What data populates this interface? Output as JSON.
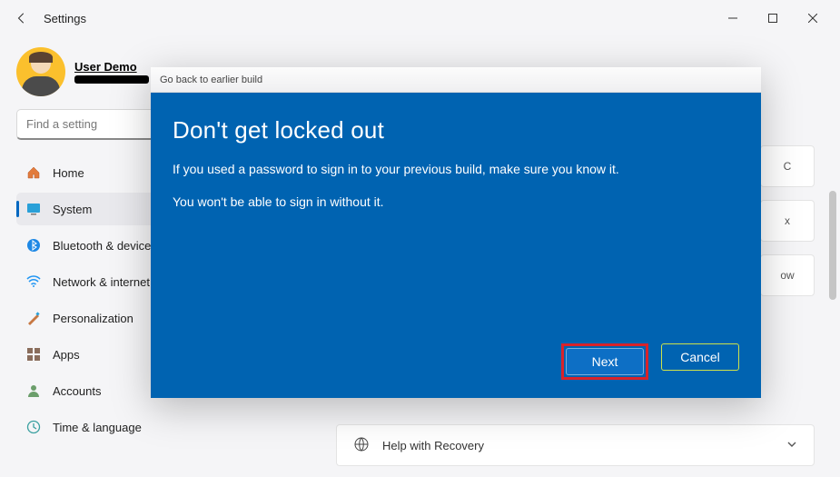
{
  "window": {
    "title": "Settings"
  },
  "profile": {
    "name": "User Demo"
  },
  "search": {
    "placeholder": "Find a setting"
  },
  "nav": {
    "home": "Home",
    "system": "System",
    "bluetooth": "Bluetooth & devices",
    "network": "Network & internet",
    "personalization": "Personalization",
    "apps": "Apps",
    "accounts": "Accounts",
    "time": "Time & language"
  },
  "content": {
    "peek_cards": {
      "a": "C",
      "b": "x",
      "c": "ow"
    },
    "help_label": "Help with Recovery"
  },
  "dialog": {
    "title": "Go back to earlier build",
    "heading": "Don't get locked out",
    "p1": "If you used a password to sign in to your previous build, make sure you know it.",
    "p2": "You won't be able to sign in without it.",
    "next_label": "Next",
    "cancel_label": "Cancel"
  }
}
